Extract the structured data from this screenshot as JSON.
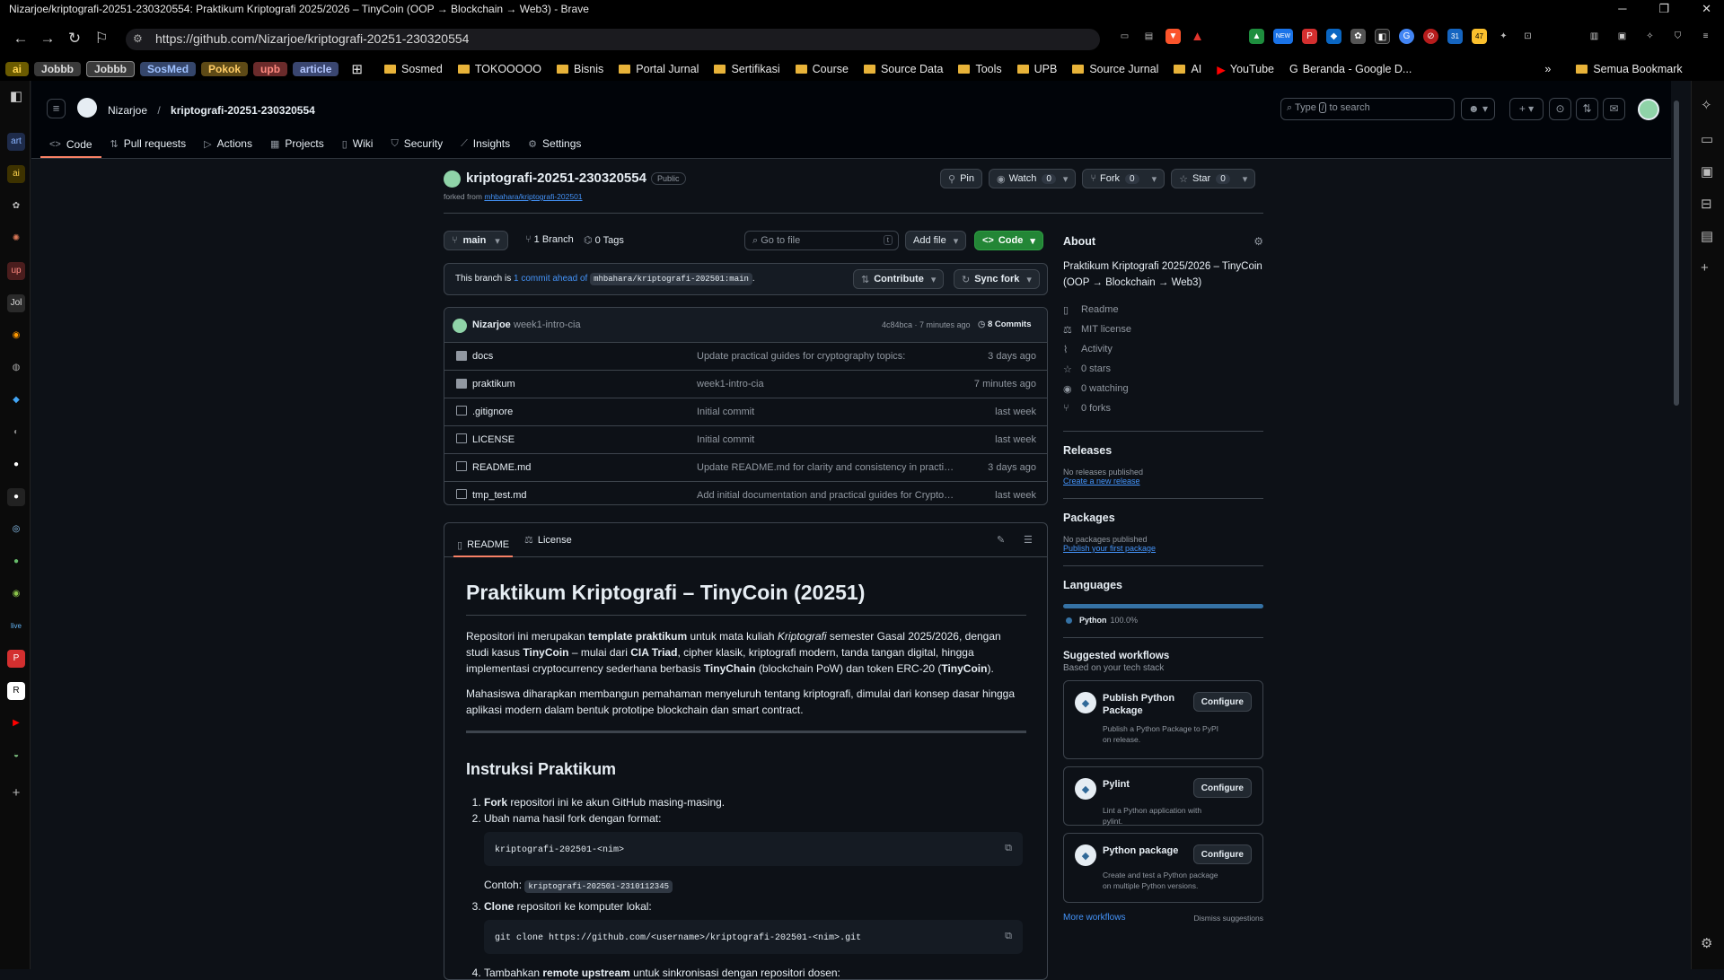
{
  "window": {
    "title": "Nizarjoe/kriptografi-20251-230320554: Praktikum Kriptografi 2025/2026 – TinyCoin (OOP → Blockchain → Web3) - Brave"
  },
  "browser": {
    "url": "https://github.com/Nizarjoe/kriptografi-20251-230320554",
    "ext_badge_new": "NEW",
    "ext_badge_count1": "31",
    "ext_badge_count2": "47"
  },
  "bookmarks": {
    "chips": [
      "ai",
      "Jobbb",
      "Jobbb",
      "SosMed",
      "Pokok",
      "upb",
      "article"
    ],
    "folders": [
      "Sosmed",
      "TOKOOOOO",
      "Bisnis",
      "Portal Jurnal",
      "Sertifikasi",
      "Course",
      "Source Data",
      "Tools",
      "UPB",
      "Source Jurnal",
      "AI"
    ],
    "youtube": "YouTube",
    "google": "Beranda - Google D...",
    "more": "»",
    "all": "Semua Bookmark"
  },
  "sidebar_left": {
    "labels": [
      "art",
      "ai",
      "up",
      "Jol",
      "live"
    ]
  },
  "github": {
    "owner": "Nizarjoe",
    "repo": "kriptografi-20251-230320554",
    "search_placeholder": "Type / to search",
    "search_pre": "Type",
    "search_key": "/",
    "search_post": "to search",
    "tabs": [
      "Code",
      "Pull requests",
      "Actions",
      "Projects",
      "Wiki",
      "Security",
      "Insights",
      "Settings"
    ]
  },
  "repo": {
    "name": "kriptografi-20251-230320554",
    "visibility": "Public",
    "forked_label": "forked from",
    "forked_from": "mhbahara/kriptografi-202501",
    "pin": "Pin",
    "watch": "Watch",
    "watch_count": "0",
    "fork": "Fork",
    "fork_count": "0",
    "star": "Star",
    "star_count": "0",
    "branch": "main",
    "branches": "1 Branch",
    "tags": "0 Tags",
    "goto_file": "Go to file",
    "goto_key": "t",
    "add_file": "Add file",
    "code_btn": "Code",
    "ahead_pre": "This branch is",
    "ahead_link": "1 commit ahead of",
    "ahead_ref": "mhbahara/kriptografi-202501:main",
    "ahead_post": ".",
    "contribute": "Contribute",
    "sync": "Sync fork",
    "last_author": "Nizarjoe",
    "last_msg": "week1-intro-cia",
    "last_hash": "4c84bca · 7 minutes ago",
    "commits": "8 Commits",
    "files": [
      {
        "name": "docs",
        "type": "dir",
        "msg": "Update practical guides for cryptography topics:",
        "date": "3 days ago"
      },
      {
        "name": "praktikum",
        "type": "dir",
        "msg": "week1-intro-cia",
        "date": "7 minutes ago"
      },
      {
        "name": ".gitignore",
        "type": "file",
        "msg": "Initial commit",
        "date": "last week"
      },
      {
        "name": "LICENSE",
        "type": "file",
        "msg": "Initial commit",
        "date": "last week"
      },
      {
        "name": "README.md",
        "type": "file",
        "msg": "Update README.md for clarity and consistency in practical i...",
        "date": "3 days ago"
      },
      {
        "name": "tmp_test.md",
        "type": "file",
        "msg": "Add initial documentation and practical guides for Cryptogr...",
        "date": "last week"
      }
    ]
  },
  "readme": {
    "tab_readme": "README",
    "tab_license": "License",
    "h1": "Praktikum Kriptografi – TinyCoin (20251)",
    "p1_a": "Repositori ini merupakan ",
    "p1_b": "template praktikum",
    "p1_c": " untuk mata kuliah ",
    "p1_d": "Kriptografi",
    "p1_e": " semester Gasal 2025/2026, dengan studi kasus ",
    "p1_f": "TinyCoin",
    "p1_g": " – mulai dari ",
    "p1_h": "CIA Triad",
    "p1_i": ", cipher klasik, kriptografi modern, tanda tangan digital, hingga implementasi cryptocurrency sederhana berbasis ",
    "p1_j": "TinyChain",
    "p1_k": " (blockchain PoW) dan token ERC-20 (",
    "p1_l": "TinyCoin",
    "p1_m": ").",
    "p2": "Mahasiswa diharapkan membangun pemahaman menyeluruh tentang kriptografi, dimulai dari konsep dasar hingga aplikasi modern dalam bentuk prototipe blockchain dan smart contract.",
    "h2": "Instruksi Praktikum",
    "s1_a": "Fork",
    "s1_b": " repositori ini ke akun GitHub masing-masing.",
    "s2": "Ubah nama hasil fork dengan format:",
    "code1": "kriptografi-202501-<nim>",
    "example_label": "Contoh:",
    "example_code": "kriptografi-202501-2310112345",
    "s3_a": "Clone",
    "s3_b": " repositori ke komputer lokal:",
    "code2": "git clone https://github.com/<username>/kriptografi-202501-<nim>.git",
    "s4_a": "Tambahkan ",
    "s4_b": "remote upstream",
    "s4_c": " untuk sinkronisasi dengan repositori dosen:"
  },
  "about": {
    "title": "About",
    "desc": "Praktikum Kriptografi 2025/2026 – TinyCoin (OOP → Blockchain → Web3)",
    "items": [
      "Readme",
      "MIT license",
      "Activity",
      "0 stars",
      "0 watching",
      "0 forks"
    ],
    "releases": "Releases",
    "no_releases": "No releases published",
    "create_release": "Create a new release",
    "packages": "Packages",
    "no_packages": "No packages published",
    "publish_package": "Publish your first package",
    "languages": "Languages",
    "lang": "Python",
    "lang_pct": "100.0%",
    "lang_color": "#3572A5",
    "suggested": "Suggested workflows",
    "based": "Based on your tech stack",
    "workflows": [
      {
        "name": "Publish Python Package",
        "desc": "Publish a Python Package to PyPI on release.",
        "btn": "Configure"
      },
      {
        "name": "Pylint",
        "desc": "Lint a Python application with pylint.",
        "btn": "Configure"
      },
      {
        "name": "Python package",
        "desc": "Create and test a Python package on multiple Python versions.",
        "btn": "Configure"
      }
    ],
    "more_workflows": "More workflows",
    "dismiss": "Dismiss suggestions"
  }
}
